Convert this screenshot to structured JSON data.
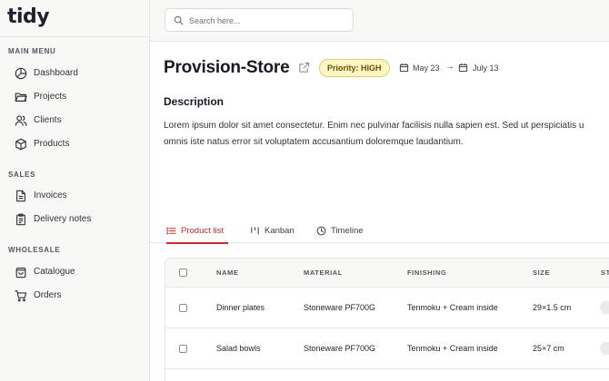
{
  "app": {
    "logo": "tidy"
  },
  "sidebar": {
    "sections": [
      {
        "title": "MAIN MENU",
        "items": [
          {
            "label": "Dashboard",
            "icon": "dashboard-icon"
          },
          {
            "label": "Projects",
            "icon": "folder-icon"
          },
          {
            "label": "Clients",
            "icon": "users-icon"
          },
          {
            "label": "Products",
            "icon": "box-icon"
          }
        ]
      },
      {
        "title": "SALES",
        "items": [
          {
            "label": "Invoices",
            "icon": "file-icon"
          },
          {
            "label": "Delivery notes",
            "icon": "clipboard-icon"
          }
        ]
      },
      {
        "title": "WHOLESALE",
        "items": [
          {
            "label": "Catalogue",
            "icon": "bag-icon"
          },
          {
            "label": "Orders",
            "icon": "cart-icon"
          }
        ]
      }
    ]
  },
  "search": {
    "placeholder": "Search here..."
  },
  "project": {
    "title": "Provision-Store",
    "priority": "Priority: HIGH",
    "start_date": "May 23",
    "end_date": "July 13",
    "arrow": "→"
  },
  "description": {
    "heading": "Description",
    "line1": "Lorem ipsum dolor sit amet consectetur. Enim nec pulvinar facilisis nulla sapien est. Sed ut perspiciatis u",
    "line2": "omnis iste natus error sit voluptatem accusantium doloremque laudantium."
  },
  "tabs": [
    {
      "label": "Product list",
      "active": true
    },
    {
      "label": "Kanban",
      "active": false
    },
    {
      "label": "Timeline",
      "active": false
    }
  ],
  "table": {
    "columns": [
      "NAME",
      "MATERIAL",
      "FINISHING",
      "SIZE",
      "ST"
    ],
    "rows": [
      {
        "name": "Dinner plates",
        "material": "Stoneware PF700G",
        "finishing": "Tenmoku + Cream inside",
        "size": "29×1.5 cm"
      },
      {
        "name": "Salad bowls",
        "material": "Stoneware PF700G",
        "finishing": "Tenmoku + Cream inside",
        "size": "25×7 cm"
      }
    ]
  },
  "colors": {
    "accent": "#c8282f",
    "badge_bg": "#fdf5c4",
    "sidebar_bg": "#f8f8f6"
  }
}
